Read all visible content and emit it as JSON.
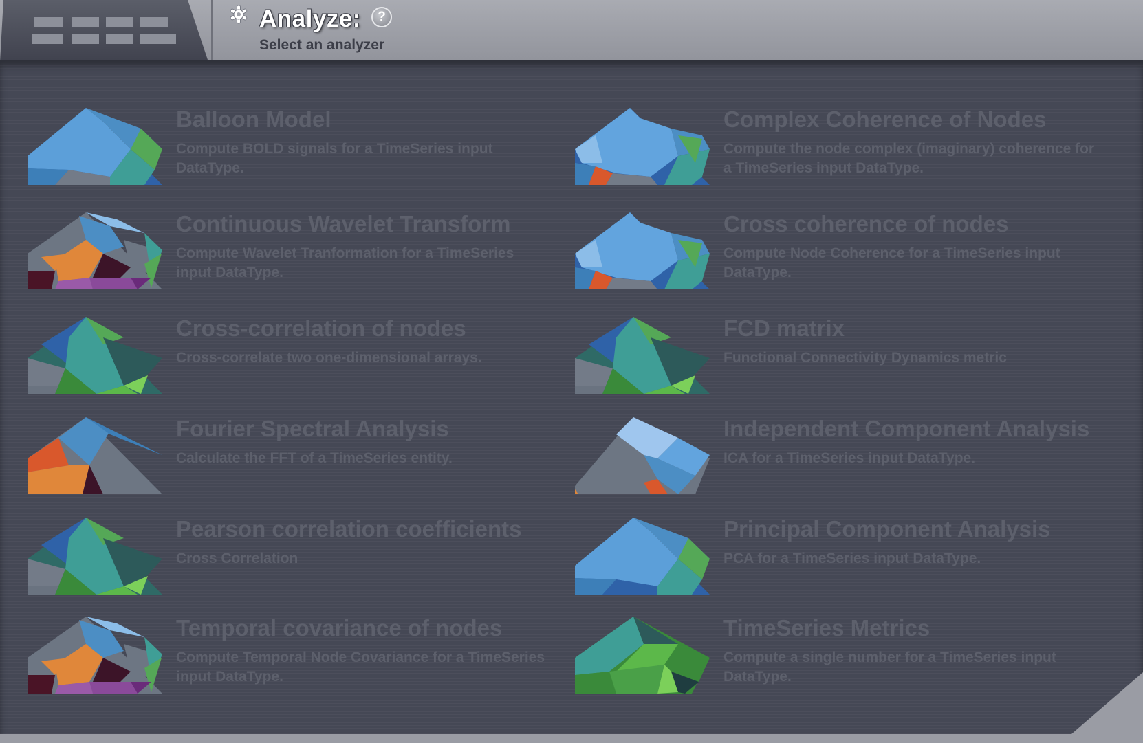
{
  "header": {
    "title": "Analyze:",
    "subtitle": "Select an analyzer",
    "help_icon_glyph": "?",
    "menu_icon": "grid-menu-icon",
    "gear_icon": "gear-icon"
  },
  "colors": {
    "panel_background": "#454855",
    "item_text": "#5d606c",
    "header_background": "#a0a2a9"
  },
  "analyzers": [
    {
      "title": "Balloon Model",
      "description": "Compute BOLD signals for a TimeSeries input DataType."
    },
    {
      "title": "Complex Coherence of Nodes",
      "description": "Compute the node complex (imaginary) coherence for a TimeSeries input DataType."
    },
    {
      "title": "Continuous Wavelet Transform",
      "description": "Compute Wavelet Tranformation for a TimeSeries input DataType."
    },
    {
      "title": "Cross coherence of nodes",
      "description": "Compute Node Coherence for a TimeSeries input DataType."
    },
    {
      "title": "Cross-correlation of nodes",
      "description": "Cross-correlate two one-dimensional arrays."
    },
    {
      "title": "FCD matrix",
      "description": "Functional Connectivity Dynamics metric"
    },
    {
      "title": "Fourier Spectral Analysis",
      "description": "Calculate the FFT of a TimeSeries entity."
    },
    {
      "title": "Independent Component Analysis",
      "description": "ICA for a TimeSeries input DataType."
    },
    {
      "title": "Pearson correlation coefficients",
      "description": "Cross Correlation"
    },
    {
      "title": "Principal Component Analysis",
      "description": "PCA for a TimeSeries input DataType."
    },
    {
      "title": "Temporal covariance of nodes",
      "description": "Compute Temporal Node Covariance for a TimeSeries input DataType."
    },
    {
      "title": "TimeSeries Metrics",
      "description": "Compute a single number for a TimeSeries input DataType."
    }
  ]
}
